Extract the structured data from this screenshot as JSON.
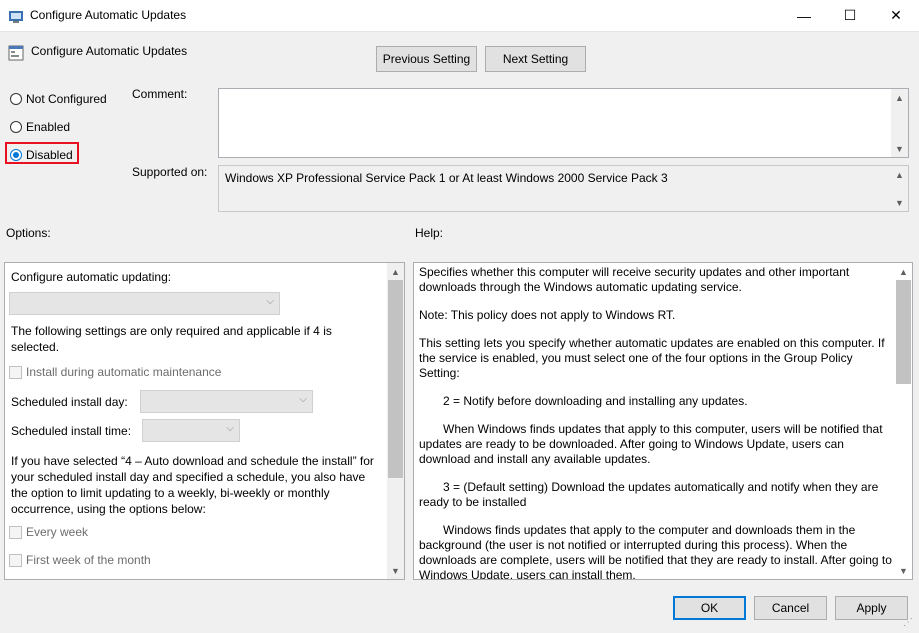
{
  "window": {
    "title": "Configure Automatic Updates",
    "minimize_glyph": "—",
    "maximize_glyph": "☐",
    "close_glyph": "✕"
  },
  "header": {
    "policy_name": "Configure Automatic Updates",
    "prev_button": "Previous Setting",
    "next_button": "Next Setting"
  },
  "state": {
    "options": [
      {
        "label": "Not Configured",
        "selected": false
      },
      {
        "label": "Enabled",
        "selected": false
      },
      {
        "label": "Disabled",
        "selected": true
      }
    ],
    "highlight_color": "#e81123"
  },
  "fields": {
    "comment_label": "Comment:",
    "comment_value": "",
    "supported_label": "Supported on:",
    "supported_value": "Windows XP Professional Service Pack 1 or At least Windows 2000 Service Pack 3"
  },
  "options_panel": {
    "label": "Options:",
    "configure_label": "Configure automatic updating:",
    "configure_value": "",
    "note": "The following settings are only required and applicable if 4 is selected.",
    "install_maintenance": "Install during automatic maintenance",
    "install_day_label": "Scheduled install day:",
    "install_time_label": "Scheduled install time:",
    "schedule_note": "If you have selected “4 – Auto download and schedule the install” for your scheduled install day and specified a schedule, you also have the option to limit updating to a weekly, bi-weekly or monthly occurrence, using the options below:",
    "every_week": "Every week",
    "first_week": "First week of the month"
  },
  "help_panel": {
    "label": "Help:",
    "p1": "Specifies whether this computer will receive security updates and other important downloads through the Windows automatic updating service.",
    "p2": "Note: This policy does not apply to Windows RT.",
    "p3": "This setting lets you specify whether automatic updates are enabled on this computer. If the service is enabled, you must select one of the four options in the Group Policy Setting:",
    "p4": "2 = Notify before downloading and installing any updates.",
    "p5": "When Windows finds updates that apply to this computer, users will be notified that updates are ready to be downloaded. After going to Windows Update, users can download and install any available updates.",
    "p6": "3 = (Default setting) Download the updates automatically and notify when they are ready to be installed",
    "p7": "Windows finds updates that apply to the computer and downloads them in the background (the user is not notified or interrupted during this process). When the downloads are complete, users will be notified that they are ready to install. After going to Windows Update, users can install them."
  },
  "footer": {
    "ok": "OK",
    "cancel": "Cancel",
    "apply": "Apply"
  }
}
